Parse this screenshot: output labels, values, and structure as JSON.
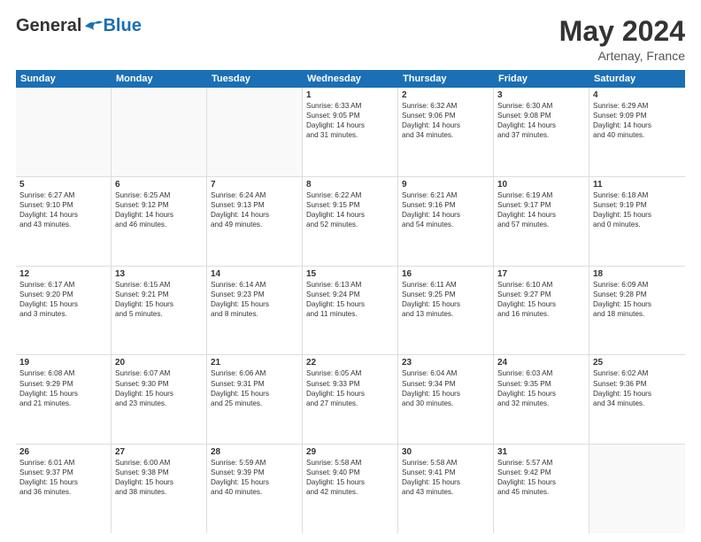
{
  "logo": {
    "general": "General",
    "blue": "Blue"
  },
  "header": {
    "month_year": "May 2024",
    "location": "Artenay, France"
  },
  "weekdays": [
    "Sunday",
    "Monday",
    "Tuesday",
    "Wednesday",
    "Thursday",
    "Friday",
    "Saturday"
  ],
  "weeks": [
    [
      {
        "day": "",
        "lines": [],
        "empty": true
      },
      {
        "day": "",
        "lines": [],
        "empty": true
      },
      {
        "day": "",
        "lines": [],
        "empty": true
      },
      {
        "day": "1",
        "lines": [
          "Sunrise: 6:33 AM",
          "Sunset: 9:05 PM",
          "Daylight: 14 hours",
          "and 31 minutes."
        ],
        "empty": false
      },
      {
        "day": "2",
        "lines": [
          "Sunrise: 6:32 AM",
          "Sunset: 9:06 PM",
          "Daylight: 14 hours",
          "and 34 minutes."
        ],
        "empty": false
      },
      {
        "day": "3",
        "lines": [
          "Sunrise: 6:30 AM",
          "Sunset: 9:08 PM",
          "Daylight: 14 hours",
          "and 37 minutes."
        ],
        "empty": false
      },
      {
        "day": "4",
        "lines": [
          "Sunrise: 6:29 AM",
          "Sunset: 9:09 PM",
          "Daylight: 14 hours",
          "and 40 minutes."
        ],
        "empty": false
      }
    ],
    [
      {
        "day": "5",
        "lines": [
          "Sunrise: 6:27 AM",
          "Sunset: 9:10 PM",
          "Daylight: 14 hours",
          "and 43 minutes."
        ],
        "empty": false
      },
      {
        "day": "6",
        "lines": [
          "Sunrise: 6:25 AM",
          "Sunset: 9:12 PM",
          "Daylight: 14 hours",
          "and 46 minutes."
        ],
        "empty": false
      },
      {
        "day": "7",
        "lines": [
          "Sunrise: 6:24 AM",
          "Sunset: 9:13 PM",
          "Daylight: 14 hours",
          "and 49 minutes."
        ],
        "empty": false
      },
      {
        "day": "8",
        "lines": [
          "Sunrise: 6:22 AM",
          "Sunset: 9:15 PM",
          "Daylight: 14 hours",
          "and 52 minutes."
        ],
        "empty": false
      },
      {
        "day": "9",
        "lines": [
          "Sunrise: 6:21 AM",
          "Sunset: 9:16 PM",
          "Daylight: 14 hours",
          "and 54 minutes."
        ],
        "empty": false
      },
      {
        "day": "10",
        "lines": [
          "Sunrise: 6:19 AM",
          "Sunset: 9:17 PM",
          "Daylight: 14 hours",
          "and 57 minutes."
        ],
        "empty": false
      },
      {
        "day": "11",
        "lines": [
          "Sunrise: 6:18 AM",
          "Sunset: 9:19 PM",
          "Daylight: 15 hours",
          "and 0 minutes."
        ],
        "empty": false
      }
    ],
    [
      {
        "day": "12",
        "lines": [
          "Sunrise: 6:17 AM",
          "Sunset: 9:20 PM",
          "Daylight: 15 hours",
          "and 3 minutes."
        ],
        "empty": false
      },
      {
        "day": "13",
        "lines": [
          "Sunrise: 6:15 AM",
          "Sunset: 9:21 PM",
          "Daylight: 15 hours",
          "and 5 minutes."
        ],
        "empty": false
      },
      {
        "day": "14",
        "lines": [
          "Sunrise: 6:14 AM",
          "Sunset: 9:23 PM",
          "Daylight: 15 hours",
          "and 8 minutes."
        ],
        "empty": false
      },
      {
        "day": "15",
        "lines": [
          "Sunrise: 6:13 AM",
          "Sunset: 9:24 PM",
          "Daylight: 15 hours",
          "and 11 minutes."
        ],
        "empty": false
      },
      {
        "day": "16",
        "lines": [
          "Sunrise: 6:11 AM",
          "Sunset: 9:25 PM",
          "Daylight: 15 hours",
          "and 13 minutes."
        ],
        "empty": false
      },
      {
        "day": "17",
        "lines": [
          "Sunrise: 6:10 AM",
          "Sunset: 9:27 PM",
          "Daylight: 15 hours",
          "and 16 minutes."
        ],
        "empty": false
      },
      {
        "day": "18",
        "lines": [
          "Sunrise: 6:09 AM",
          "Sunset: 9:28 PM",
          "Daylight: 15 hours",
          "and 18 minutes."
        ],
        "empty": false
      }
    ],
    [
      {
        "day": "19",
        "lines": [
          "Sunrise: 6:08 AM",
          "Sunset: 9:29 PM",
          "Daylight: 15 hours",
          "and 21 minutes."
        ],
        "empty": false
      },
      {
        "day": "20",
        "lines": [
          "Sunrise: 6:07 AM",
          "Sunset: 9:30 PM",
          "Daylight: 15 hours",
          "and 23 minutes."
        ],
        "empty": false
      },
      {
        "day": "21",
        "lines": [
          "Sunrise: 6:06 AM",
          "Sunset: 9:31 PM",
          "Daylight: 15 hours",
          "and 25 minutes."
        ],
        "empty": false
      },
      {
        "day": "22",
        "lines": [
          "Sunrise: 6:05 AM",
          "Sunset: 9:33 PM",
          "Daylight: 15 hours",
          "and 27 minutes."
        ],
        "empty": false
      },
      {
        "day": "23",
        "lines": [
          "Sunrise: 6:04 AM",
          "Sunset: 9:34 PM",
          "Daylight: 15 hours",
          "and 30 minutes."
        ],
        "empty": false
      },
      {
        "day": "24",
        "lines": [
          "Sunrise: 6:03 AM",
          "Sunset: 9:35 PM",
          "Daylight: 15 hours",
          "and 32 minutes."
        ],
        "empty": false
      },
      {
        "day": "25",
        "lines": [
          "Sunrise: 6:02 AM",
          "Sunset: 9:36 PM",
          "Daylight: 15 hours",
          "and 34 minutes."
        ],
        "empty": false
      }
    ],
    [
      {
        "day": "26",
        "lines": [
          "Sunrise: 6:01 AM",
          "Sunset: 9:37 PM",
          "Daylight: 15 hours",
          "and 36 minutes."
        ],
        "empty": false
      },
      {
        "day": "27",
        "lines": [
          "Sunrise: 6:00 AM",
          "Sunset: 9:38 PM",
          "Daylight: 15 hours",
          "and 38 minutes."
        ],
        "empty": false
      },
      {
        "day": "28",
        "lines": [
          "Sunrise: 5:59 AM",
          "Sunset: 9:39 PM",
          "Daylight: 15 hours",
          "and 40 minutes."
        ],
        "empty": false
      },
      {
        "day": "29",
        "lines": [
          "Sunrise: 5:58 AM",
          "Sunset: 9:40 PM",
          "Daylight: 15 hours",
          "and 42 minutes."
        ],
        "empty": false
      },
      {
        "day": "30",
        "lines": [
          "Sunrise: 5:58 AM",
          "Sunset: 9:41 PM",
          "Daylight: 15 hours",
          "and 43 minutes."
        ],
        "empty": false
      },
      {
        "day": "31",
        "lines": [
          "Sunrise: 5:57 AM",
          "Sunset: 9:42 PM",
          "Daylight: 15 hours",
          "and 45 minutes."
        ],
        "empty": false
      },
      {
        "day": "",
        "lines": [],
        "empty": true
      }
    ]
  ]
}
